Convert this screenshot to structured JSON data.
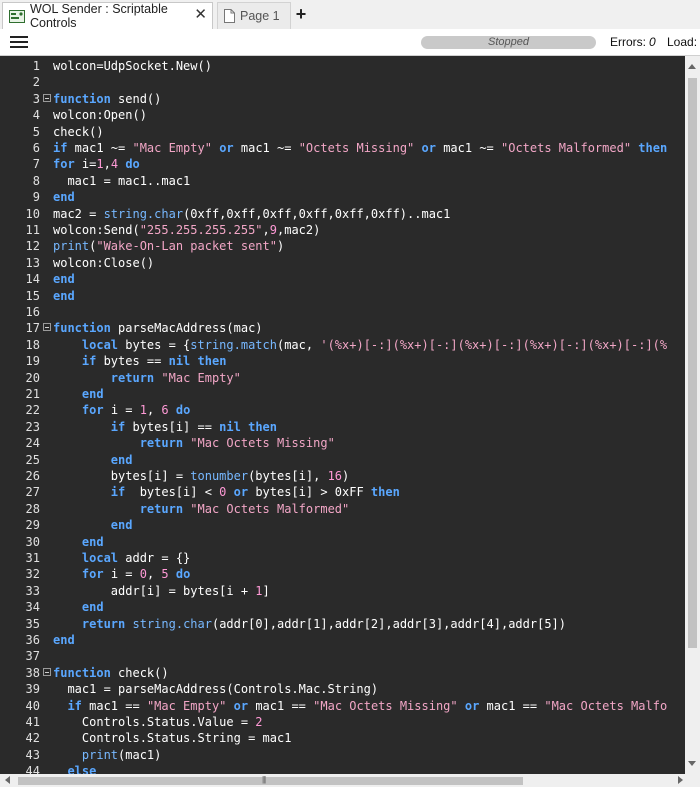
{
  "tabs": [
    {
      "label": "WOL Sender : Scriptable Controls",
      "icon": "control-panel-icon",
      "active": true
    },
    {
      "label": "Page 1",
      "icon": "page-icon",
      "active": false
    }
  ],
  "toolbar": {
    "menu_icon": "hamburger-menu-icon",
    "status": "Stopped",
    "errors_label": "Errors:",
    "errors_value": "0",
    "load_label": "Load:"
  },
  "colors": {
    "editor_bg": "#2a2a2a",
    "keyword": "#5aa7ff",
    "string": "#f2a6c6",
    "number": "#ff9ad6",
    "plain": "#ffffff"
  },
  "code_lines": [
    {
      "n": "1",
      "fold": false,
      "tokens": [
        [
          "p",
          "wolcon=UdpSocket.New()"
        ]
      ]
    },
    {
      "n": "2",
      "fold": false,
      "tokens": []
    },
    {
      "n": "3",
      "fold": true,
      "tokens": [
        [
          "k",
          "function"
        ],
        [
          "p",
          " send()"
        ]
      ]
    },
    {
      "n": "4",
      "fold": false,
      "tokens": [
        [
          "p",
          "wolcon:Open()"
        ]
      ]
    },
    {
      "n": "5",
      "fold": false,
      "tokens": [
        [
          "p",
          "check()"
        ]
      ]
    },
    {
      "n": "6",
      "fold": false,
      "tokens": [
        [
          "k",
          "if"
        ],
        [
          "p",
          " mac1 ~= "
        ],
        [
          "s",
          "\"Mac Empty\""
        ],
        [
          "p",
          " "
        ],
        [
          "k",
          "or"
        ],
        [
          "p",
          " mac1 ~= "
        ],
        [
          "s",
          "\"Octets Missing\""
        ],
        [
          "p",
          " "
        ],
        [
          "k",
          "or"
        ],
        [
          "p",
          " mac1 ~= "
        ],
        [
          "s",
          "\"Octets Malformed\""
        ],
        [
          "p",
          " "
        ],
        [
          "k",
          "then"
        ]
      ]
    },
    {
      "n": "7",
      "fold": false,
      "tokens": [
        [
          "k",
          "for"
        ],
        [
          "p",
          " i="
        ],
        [
          "n",
          "1"
        ],
        [
          "p",
          ","
        ],
        [
          "n",
          "4"
        ],
        [
          "p",
          " "
        ],
        [
          "k",
          "do"
        ]
      ]
    },
    {
      "n": "8",
      "fold": false,
      "tokens": [
        [
          "p",
          "  mac1 = mac1..mac1"
        ]
      ]
    },
    {
      "n": "9",
      "fold": false,
      "tokens": [
        [
          "k",
          "end"
        ]
      ]
    },
    {
      "n": "10",
      "fold": false,
      "tokens": [
        [
          "p",
          "mac2 = "
        ],
        [
          "f",
          "string.char"
        ],
        [
          "p",
          "(0xff,0xff,0xff,0xff,0xff,0xff)..mac1"
        ]
      ]
    },
    {
      "n": "11",
      "fold": false,
      "tokens": [
        [
          "p",
          "wolcon:Send("
        ],
        [
          "s",
          "\"255.255.255.255\""
        ],
        [
          "p",
          ","
        ],
        [
          "n",
          "9"
        ],
        [
          "p",
          ",mac2)"
        ]
      ]
    },
    {
      "n": "12",
      "fold": false,
      "tokens": [
        [
          "f",
          "print"
        ],
        [
          "p",
          "("
        ],
        [
          "s",
          "\"Wake-On-Lan packet sent\""
        ],
        [
          "p",
          ")"
        ]
      ]
    },
    {
      "n": "13",
      "fold": false,
      "tokens": [
        [
          "p",
          "wolcon:Close()"
        ]
      ]
    },
    {
      "n": "14",
      "fold": false,
      "tokens": [
        [
          "k",
          "end"
        ]
      ]
    },
    {
      "n": "15",
      "fold": false,
      "tokens": [
        [
          "k",
          "end"
        ]
      ]
    },
    {
      "n": "16",
      "fold": false,
      "tokens": []
    },
    {
      "n": "17",
      "fold": true,
      "tokens": [
        [
          "k",
          "function"
        ],
        [
          "p",
          " parseMacAddress(mac)"
        ]
      ]
    },
    {
      "n": "18",
      "fold": false,
      "tokens": [
        [
          "p",
          "    "
        ],
        [
          "k",
          "local"
        ],
        [
          "p",
          " bytes = {"
        ],
        [
          "f",
          "string.match"
        ],
        [
          "p",
          "(mac, "
        ],
        [
          "s",
          "'(%x+)[-:](%x+)[-:](%x+)[-:](%x+)[-:](%x+)[-:](%"
        ]
      ]
    },
    {
      "n": "19",
      "fold": false,
      "tokens": [
        [
          "p",
          "    "
        ],
        [
          "k",
          "if"
        ],
        [
          "p",
          " bytes == "
        ],
        [
          "k",
          "nil"
        ],
        [
          "p",
          " "
        ],
        [
          "k",
          "then"
        ]
      ]
    },
    {
      "n": "20",
      "fold": false,
      "tokens": [
        [
          "p",
          "        "
        ],
        [
          "k",
          "return"
        ],
        [
          "p",
          " "
        ],
        [
          "s",
          "\"Mac Empty\""
        ]
      ]
    },
    {
      "n": "21",
      "fold": false,
      "tokens": [
        [
          "p",
          "    "
        ],
        [
          "k",
          "end"
        ]
      ]
    },
    {
      "n": "22",
      "fold": false,
      "tokens": [
        [
          "p",
          "    "
        ],
        [
          "k",
          "for"
        ],
        [
          "p",
          " i = "
        ],
        [
          "n",
          "1"
        ],
        [
          "p",
          ", "
        ],
        [
          "n",
          "6"
        ],
        [
          "p",
          " "
        ],
        [
          "k",
          "do"
        ]
      ]
    },
    {
      "n": "23",
      "fold": false,
      "tokens": [
        [
          "p",
          "        "
        ],
        [
          "k",
          "if"
        ],
        [
          "p",
          " bytes[i] == "
        ],
        [
          "k",
          "nil"
        ],
        [
          "p",
          " "
        ],
        [
          "k",
          "then"
        ]
      ]
    },
    {
      "n": "24",
      "fold": false,
      "tokens": [
        [
          "p",
          "            "
        ],
        [
          "k",
          "return"
        ],
        [
          "p",
          " "
        ],
        [
          "s",
          "\"Mac Octets Missing\""
        ]
      ]
    },
    {
      "n": "25",
      "fold": false,
      "tokens": [
        [
          "p",
          "        "
        ],
        [
          "k",
          "end"
        ]
      ]
    },
    {
      "n": "26",
      "fold": false,
      "tokens": [
        [
          "p",
          "        bytes[i] = "
        ],
        [
          "f",
          "tonumber"
        ],
        [
          "p",
          "(bytes[i], "
        ],
        [
          "n",
          "16"
        ],
        [
          "p",
          ")"
        ]
      ]
    },
    {
      "n": "27",
      "fold": false,
      "tokens": [
        [
          "p",
          "        "
        ],
        [
          "k",
          "if"
        ],
        [
          "p",
          "  bytes[i] < "
        ],
        [
          "n",
          "0"
        ],
        [
          "p",
          " "
        ],
        [
          "k",
          "or"
        ],
        [
          "p",
          " bytes[i] > 0xFF "
        ],
        [
          "k",
          "then"
        ]
      ]
    },
    {
      "n": "28",
      "fold": false,
      "tokens": [
        [
          "p",
          "            "
        ],
        [
          "k",
          "return"
        ],
        [
          "p",
          " "
        ],
        [
          "s",
          "\"Mac Octets Malformed\""
        ]
      ]
    },
    {
      "n": "29",
      "fold": false,
      "tokens": [
        [
          "p",
          "        "
        ],
        [
          "k",
          "end"
        ]
      ]
    },
    {
      "n": "30",
      "fold": false,
      "tokens": [
        [
          "p",
          "    "
        ],
        [
          "k",
          "end"
        ]
      ]
    },
    {
      "n": "31",
      "fold": false,
      "tokens": [
        [
          "p",
          "    "
        ],
        [
          "k",
          "local"
        ],
        [
          "p",
          " addr = {}"
        ]
      ]
    },
    {
      "n": "32",
      "fold": false,
      "tokens": [
        [
          "p",
          "    "
        ],
        [
          "k",
          "for"
        ],
        [
          "p",
          " i = "
        ],
        [
          "n",
          "0"
        ],
        [
          "p",
          ", "
        ],
        [
          "n",
          "5"
        ],
        [
          "p",
          " "
        ],
        [
          "k",
          "do"
        ]
      ]
    },
    {
      "n": "33",
      "fold": false,
      "tokens": [
        [
          "p",
          "        addr[i] = bytes[i + "
        ],
        [
          "n",
          "1"
        ],
        [
          "p",
          "]"
        ]
      ]
    },
    {
      "n": "34",
      "fold": false,
      "tokens": [
        [
          "p",
          "    "
        ],
        [
          "k",
          "end"
        ]
      ]
    },
    {
      "n": "35",
      "fold": false,
      "tokens": [
        [
          "p",
          "    "
        ],
        [
          "k",
          "return"
        ],
        [
          "p",
          " "
        ],
        [
          "f",
          "string.char"
        ],
        [
          "p",
          "(addr[0],addr[1],addr[2],addr[3],addr[4],addr[5])"
        ]
      ]
    },
    {
      "n": "36",
      "fold": false,
      "tokens": [
        [
          "k",
          "end"
        ]
      ]
    },
    {
      "n": "37",
      "fold": false,
      "tokens": []
    },
    {
      "n": "38",
      "fold": true,
      "tokens": [
        [
          "k",
          "function"
        ],
        [
          "p",
          " check()"
        ]
      ]
    },
    {
      "n": "39",
      "fold": false,
      "tokens": [
        [
          "p",
          "  mac1 = parseMacAddress(Controls.Mac.String)"
        ]
      ]
    },
    {
      "n": "40",
      "fold": false,
      "tokens": [
        [
          "p",
          "  "
        ],
        [
          "k",
          "if"
        ],
        [
          "p",
          " mac1 == "
        ],
        [
          "s",
          "\"Mac Empty\""
        ],
        [
          "p",
          " "
        ],
        [
          "k",
          "or"
        ],
        [
          "p",
          " mac1 == "
        ],
        [
          "s",
          "\"Mac Octets Missing\""
        ],
        [
          "p",
          " "
        ],
        [
          "k",
          "or"
        ],
        [
          "p",
          " mac1 == "
        ],
        [
          "s",
          "\"Mac Octets Malfo"
        ]
      ]
    },
    {
      "n": "41",
      "fold": false,
      "tokens": [
        [
          "p",
          "    Controls.Status.Value = "
        ],
        [
          "n",
          "2"
        ]
      ]
    },
    {
      "n": "42",
      "fold": false,
      "tokens": [
        [
          "p",
          "    Controls.Status.String = mac1"
        ]
      ]
    },
    {
      "n": "43",
      "fold": false,
      "tokens": [
        [
          "p",
          "    "
        ],
        [
          "f",
          "print"
        ],
        [
          "p",
          "(mac1)"
        ]
      ]
    },
    {
      "n": "44",
      "fold": false,
      "tokens": [
        [
          "p",
          "  "
        ],
        [
          "k",
          "else"
        ]
      ]
    }
  ],
  "scrollbars": {
    "vertical_position": 0.0,
    "horizontal_position": 0.0
  }
}
